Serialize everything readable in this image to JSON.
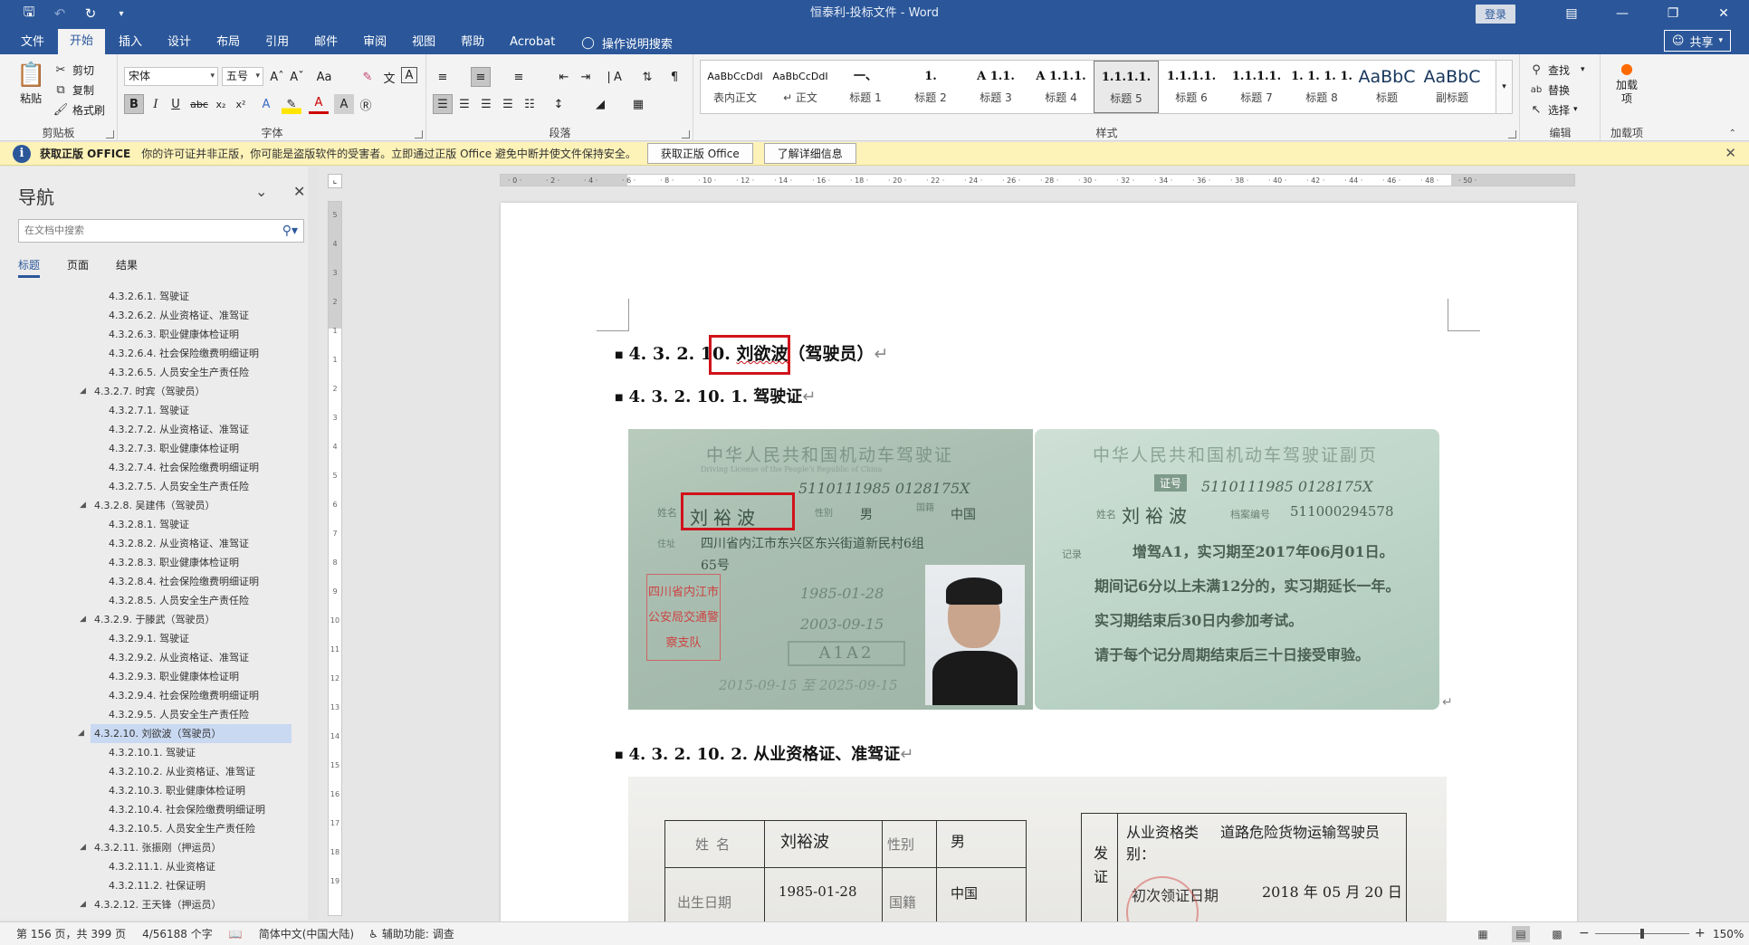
{
  "titlebar": {
    "title": "恒泰利-投标文件  -  Word",
    "login_label": "登录",
    "save_icon": "save-icon",
    "undo_icon": "undo-icon",
    "redo_icon": "redo-icon"
  },
  "tabs": [
    "文件",
    "开始",
    "插入",
    "设计",
    "布局",
    "引用",
    "邮件",
    "审阅",
    "视图",
    "帮助",
    "Acrobat"
  ],
  "active_tab": "开始",
  "tell_me": "操作说明搜索",
  "share_label": "共享",
  "ribbon": {
    "clipboard": {
      "paste": "粘贴",
      "cut": "剪切",
      "copy": "复制",
      "format_painter": "格式刷",
      "label": "剪贴板"
    },
    "font": {
      "font_name": "宋体",
      "font_size": "五号",
      "label": "字体"
    },
    "paragraph": {
      "label": "段落"
    },
    "styles": {
      "label": "样式",
      "items": [
        {
          "preview": "AaBbCcDdI",
          "name": "表内正文"
        },
        {
          "preview": "AaBbCcDdI",
          "name": "↵ 正文"
        },
        {
          "preview": "一、",
          "name": "标题 1"
        },
        {
          "preview": "1.",
          "name": "标题 2"
        },
        {
          "preview": "A 1.1.",
          "name": "标题 3"
        },
        {
          "preview": "A 1.1.1.",
          "name": "标题 4"
        },
        {
          "preview": "1.1.1.1.",
          "name": "标题 5"
        },
        {
          "preview": "1.1.1.1.",
          "name": "标题 6"
        },
        {
          "preview": "1.1.1.1.",
          "name": "标题 7"
        },
        {
          "preview": "1. 1. 1. 1.",
          "name": "标题 8"
        },
        {
          "preview": "AaBbC",
          "name": "标题"
        },
        {
          "preview": "AaBbC",
          "name": "副标题"
        }
      ],
      "selected_index": 6
    },
    "editing": {
      "find": "查找",
      "replace": "替换",
      "select": "选择",
      "label": "编辑"
    },
    "addins": {
      "button": "加载项",
      "label": "加载项"
    }
  },
  "infobar": {
    "title": "获取正版 OFFICE",
    "message": "你的许可证并非正版，你可能是盗版软件的受害者。立即通过正版 Office 避免中断并使文件保持安全。",
    "btn_get": "获取正版 Office",
    "btn_learn": "了解详细信息"
  },
  "nav": {
    "title": "导航",
    "search_placeholder": "在文档中搜索",
    "tabs": [
      "标题",
      "页面",
      "结果"
    ],
    "items": [
      {
        "text": "4.3.2.6.1. 驾驶证",
        "level": 2
      },
      {
        "text": "4.3.2.6.2. 从业资格证、准驾证",
        "level": 2
      },
      {
        "text": "4.3.2.6.3. 职业健康体检证明",
        "level": 2
      },
      {
        "text": "4.3.2.6.4. 社会保险缴费明细证明",
        "level": 2
      },
      {
        "text": "4.3.2.6.5. 人员安全生产责任险",
        "level": 2
      },
      {
        "text": "4.3.2.7. 时宾（驾驶员）",
        "level": 1
      },
      {
        "text": "4.3.2.7.1. 驾驶证",
        "level": 2
      },
      {
        "text": "4.3.2.7.2. 从业资格证、准驾证",
        "level": 2
      },
      {
        "text": "4.3.2.7.3. 职业健康体检证明",
        "level": 2
      },
      {
        "text": "4.3.2.7.4. 社会保险缴费明细证明",
        "level": 2
      },
      {
        "text": "4.3.2.7.5. 人员安全生产责任险",
        "level": 2
      },
      {
        "text": "4.3.2.8. 吴建伟（驾驶员）",
        "level": 1
      },
      {
        "text": "4.3.2.8.1. 驾驶证",
        "level": 2
      },
      {
        "text": "4.3.2.8.2. 从业资格证、准驾证",
        "level": 2
      },
      {
        "text": "4.3.2.8.3. 职业健康体检证明",
        "level": 2
      },
      {
        "text": "4.3.2.8.4. 社会保险缴费明细证明",
        "level": 2
      },
      {
        "text": "4.3.2.8.5. 人员安全生产责任险",
        "level": 2
      },
      {
        "text": "4.3.2.9. 于滕武（驾驶员）",
        "level": 1
      },
      {
        "text": "4.3.2.9.1. 驾驶证",
        "level": 2
      },
      {
        "text": "4.3.2.9.2. 从业资格证、准驾证",
        "level": 2
      },
      {
        "text": "4.3.2.9.3. 职业健康体检证明",
        "level": 2
      },
      {
        "text": "4.3.2.9.4. 社会保险缴费明细证明",
        "level": 2
      },
      {
        "text": "4.3.2.9.5. 人员安全生产责任险",
        "level": 2
      },
      {
        "text": "4.3.2.10. 刘欲波（驾驶员）",
        "level": 1,
        "selected": true
      },
      {
        "text": "4.3.2.10.1. 驾驶证",
        "level": 2
      },
      {
        "text": "4.3.2.10.2. 从业资格证、准驾证",
        "level": 2
      },
      {
        "text": "4.3.2.10.3. 职业健康体检证明",
        "level": 2
      },
      {
        "text": "4.3.2.10.4. 社会保险缴费明细证明",
        "level": 2
      },
      {
        "text": "4.3.2.10.5. 人员安全生产责任险",
        "level": 2
      },
      {
        "text": "4.3.2.11. 张振刚（押运员）",
        "level": 1
      },
      {
        "text": "4.3.2.11.1. 从业资格证",
        "level": 2
      },
      {
        "text": "4.3.2.11.2. 社保证明",
        "level": 2
      },
      {
        "text": "4.3.2.12. 王天锋（押运员）",
        "level": 1
      }
    ]
  },
  "document": {
    "heading1_num": "4. 3. 2. 10.",
    "heading1_name": "刘欲波",
    "heading1_rest": "（驾驶员）",
    "heading2": "4. 3. 2. 10. 1. 驾驶证",
    "heading3": "4. 3. 2. 10. 2. 从业资格证、准驾证",
    "para_mark": "↵",
    "license_front": {
      "title": "中华人民共和国机动车驾驶证",
      "subtitle": "Driving License of the People's Republic of China",
      "id": "5110111985 0128175X",
      "name": "刘裕波",
      "sex": "男",
      "nationality": "中国",
      "address": "四川省内江市东兴区东兴街道新民村6组",
      "address2": "65号",
      "birth": "1985-01-28",
      "first_issue": "2003-09-15",
      "class": "A1A2",
      "valid": "2015-09-15 至 2025-09-15",
      "stamp": "四川省内江市公安局交通警察支队",
      "label_name": "姓名",
      "label_sex": "性别",
      "label_nat": "国籍",
      "label_addr": "住址"
    },
    "license_back": {
      "title": "中华人民共和国机动车驾驶证副页",
      "id_label": "证号",
      "id": "5110111985 0128175X",
      "name_label": "姓名",
      "name": "刘裕波",
      "file_label": "档案编号",
      "file_no": "511000294578",
      "record_label": "记录",
      "line1": "增驾A1，实习期至2017年06月01日。",
      "line2": "期间记6分以上未满12分的，实习期延长一年。",
      "line3": "实习期结束后30日内参加考试。",
      "line4": "请于每个记分周期结束后三十日接受审验。"
    },
    "cert": {
      "name_label": "姓名",
      "name": "刘裕波",
      "sex_label": "性别",
      "sex": "男",
      "birth_label": "出生日期",
      "birth": "1985-01-28",
      "nat_label": "国籍",
      "nat": "中国",
      "type_label": "从业资格类别：",
      "type": "道路危险货物运输驾驶员",
      "issue_label": "初次领证日期",
      "issue": "2018 年 05 月 20 日",
      "side": "发证"
    }
  },
  "statusbar": {
    "page": "第 156 页，共 399 页",
    "words": "4/56188 个字",
    "lang": "简体中文(中国大陆)",
    "accessibility": "辅助功能: 调查",
    "zoom": "150%"
  }
}
